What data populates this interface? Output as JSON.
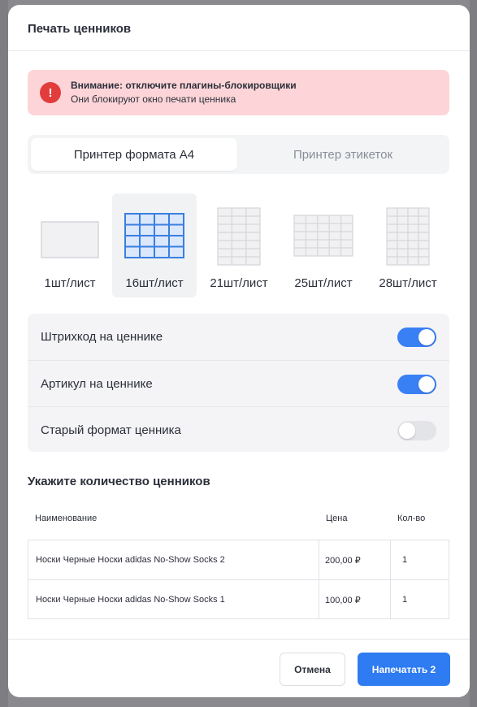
{
  "modal": {
    "title": "Печать ценников"
  },
  "alert": {
    "icon": "exclamation-icon",
    "icon_glyph": "!",
    "title": "Внимание: отключите плагины-блокировщики",
    "text": "Они блокируют окно печати ценника",
    "color": "#fdd5d8"
  },
  "tabs": [
    {
      "label": "Принтер формата А4",
      "active": true
    },
    {
      "label": "Принтер этикеток",
      "active": false
    }
  ],
  "formats": [
    {
      "label": "1шт/лист",
      "selected": false
    },
    {
      "label": "16шт/лист",
      "selected": true
    },
    {
      "label": "21шт/лист",
      "selected": false
    },
    {
      "label": "25шт/лист",
      "selected": false
    },
    {
      "label": "28шт/лист",
      "selected": false
    }
  ],
  "toggles": [
    {
      "label": "Штрихкод на ценнике",
      "on": true
    },
    {
      "label": "Артикул на ценнике",
      "on": true
    },
    {
      "label": "Старый формат ценника",
      "on": false
    }
  ],
  "quantity": {
    "title": "Укажите количество ценников",
    "columns": {
      "name": "Наименование",
      "price": "Цена",
      "qty": "Кол-во"
    },
    "rows": [
      {
        "name": "Носки Черные Носки adidas No-Show Socks 2",
        "price": "200,00 ₽",
        "qty": "1"
      },
      {
        "name": "Носки Черные Носки adidas No-Show Socks 1",
        "price": "100,00 ₽",
        "qty": "1"
      }
    ]
  },
  "footer": {
    "cancel_label": "Отмена",
    "print_label": "Напечатать 2"
  },
  "colors": {
    "accent": "#2f7bf1",
    "switch_on": "#3a80f5",
    "alert_icon": "#e23d3d"
  }
}
